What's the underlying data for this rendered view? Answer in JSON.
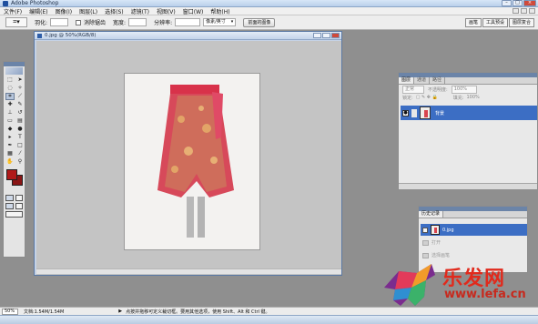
{
  "app": {
    "title": "Adobe Photoshop"
  },
  "menu": [
    "文件(F)",
    "编辑(E)",
    "图像(I)",
    "图层(L)",
    "选择(S)",
    "滤镜(T)",
    "视图(V)",
    "窗口(W)",
    "帮助(H)"
  ],
  "options": {
    "feather_label": "羽化:",
    "feather_value": "",
    "antialias_label": "消除锯齿",
    "width_label": "宽度:",
    "style_label": "分辨率:",
    "unit_select": "像素/英寸",
    "clear_button": "前面的图像",
    "well_tabs": [
      "画笔",
      "工具预设",
      "图层复合"
    ]
  },
  "document": {
    "title": "0.jpg @ 50%(RGB/8)"
  },
  "layers_panel": {
    "tabs": [
      "图层",
      "通道",
      "路径"
    ],
    "blend_mode": "正常",
    "opacity_label": "不透明度:",
    "opacity_value": "100%",
    "lock_label": "锁定:",
    "fill_label": "填充:",
    "fill_value": "100%",
    "layer_name": "背景"
  },
  "history_panel": {
    "tabs": [
      "历史记录"
    ],
    "items": [
      "0.jpg",
      "打开",
      "选择画笔"
    ]
  },
  "status": {
    "zoom": "50%",
    "doc_size": "文档:1.54M/1.54M",
    "hint": "点按并拖移可定义裁切框。要用其他选项，使用 Shift、Alt 和 Ctrl 键。"
  },
  "watermark": {
    "brand": "乐发网",
    "url": "www.lefa.cn"
  },
  "colors": {
    "foreground": "#b01a1a",
    "background": "#8a1515",
    "selection": "#3c6ec4"
  }
}
